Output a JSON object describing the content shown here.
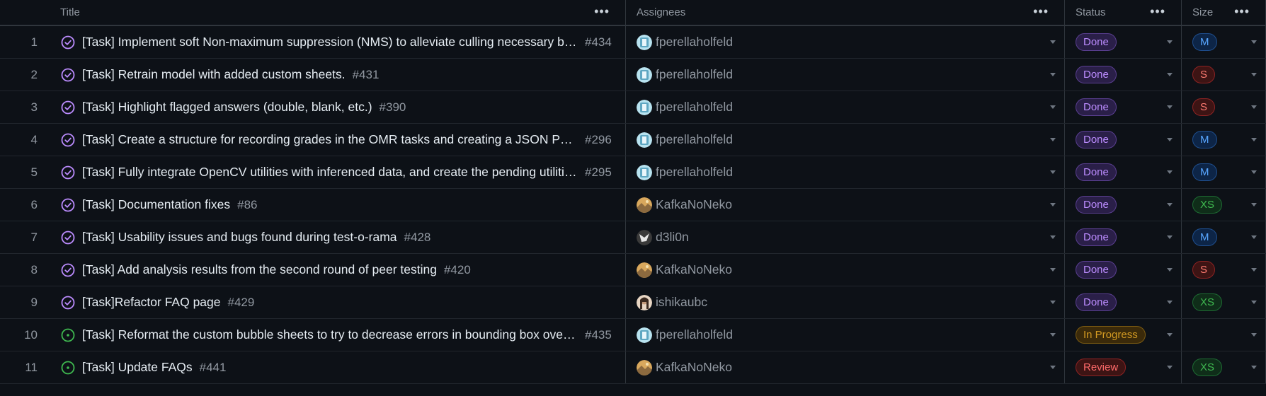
{
  "columns": {
    "title": "Title",
    "assignees": "Assignees",
    "status": "Status",
    "size": "Size"
  },
  "rows": [
    {
      "num": "1",
      "state": "closed",
      "title": "[Task] Implement soft Non-maximum suppression (NMS) to alleviate culling necessary bo...",
      "issue": "#434",
      "assignee": "fperellaholfeld",
      "avatar": "robot",
      "status": "Done",
      "size": "M"
    },
    {
      "num": "2",
      "state": "closed",
      "title": "[Task] Retrain model with added custom sheets.",
      "issue": "#431",
      "assignee": "fperellaholfeld",
      "avatar": "robot",
      "status": "Done",
      "size": "S"
    },
    {
      "num": "3",
      "state": "closed",
      "title": "[Task] Highlight flagged answers (double, blank, etc.)",
      "issue": "#390",
      "assignee": "fperellaholfeld",
      "avatar": "robot",
      "status": "Done",
      "size": "S"
    },
    {
      "num": "4",
      "state": "closed",
      "title": "[Task] Create a structure for recording grades in the OMR tasks and creating a JSON Paylo...",
      "issue": "#296",
      "assignee": "fperellaholfeld",
      "avatar": "robot",
      "status": "Done",
      "size": "M"
    },
    {
      "num": "5",
      "state": "closed",
      "title": "[Task] Fully integrate OpenCV utilities with inferenced data, and create the pending utilitie...",
      "issue": "#295",
      "assignee": "fperellaholfeld",
      "avatar": "robot",
      "status": "Done",
      "size": "M"
    },
    {
      "num": "6",
      "state": "closed",
      "title": "[Task] Documentation fixes",
      "issue": "#86",
      "assignee": "KafkaNoNeko",
      "avatar": "landscape",
      "status": "Done",
      "size": "XS"
    },
    {
      "num": "7",
      "state": "closed",
      "title": "[Task] Usability issues and bugs found during test-o-rama",
      "issue": "#428",
      "assignee": "d3li0n",
      "avatar": "dark",
      "status": "Done",
      "size": "M"
    },
    {
      "num": "8",
      "state": "closed",
      "title": "[Task] Add analysis results from the second round of peer testing",
      "issue": "#420",
      "assignee": "KafkaNoNeko",
      "avatar": "landscape",
      "status": "Done",
      "size": "S"
    },
    {
      "num": "9",
      "state": "closed",
      "title": "[Task]Refactor FAQ page",
      "issue": "#429",
      "assignee": "ishikaubc",
      "avatar": "person",
      "status": "Done",
      "size": "XS"
    },
    {
      "num": "10",
      "state": "open",
      "title": "[Task] Reformat the custom bubble sheets to try to decrease errors in bounding box overl...",
      "issue": "#435",
      "assignee": "fperellaholfeld",
      "avatar": "robot",
      "status": "In Progress",
      "size": ""
    },
    {
      "num": "11",
      "state": "open",
      "title": "[Task] Update FAQs",
      "issue": "#441",
      "assignee": "KafkaNoNeko",
      "avatar": "landscape",
      "status": "Review",
      "size": "XS"
    }
  ],
  "colors": {
    "background": "#0d1117",
    "done": "#bc8cff",
    "open": "#3fb950",
    "in_progress": "#d29922",
    "review": "#ff6b6b"
  }
}
